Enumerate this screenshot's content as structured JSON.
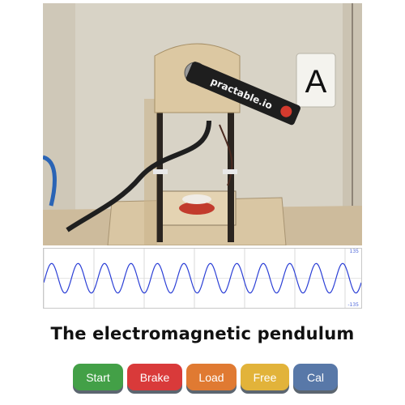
{
  "camera": {
    "label_card": "A",
    "arm_text": "practable.io"
  },
  "graph": {
    "y_max_label": "135",
    "y_min_label": "-135",
    "series_color": "#2b3fd6",
    "cycles_visible": 12,
    "amplitude_fraction": 0.5
  },
  "title": "The electromagnetic pendulum",
  "buttons": {
    "start": "Start",
    "brake": "Brake",
    "load": "Load",
    "free": "Free",
    "cal": "Cal"
  },
  "colors": {
    "start": "#43a047",
    "brake": "#d93a3a",
    "load": "#e07a32",
    "free": "#e2b33a",
    "cal": "#5878a8"
  }
}
